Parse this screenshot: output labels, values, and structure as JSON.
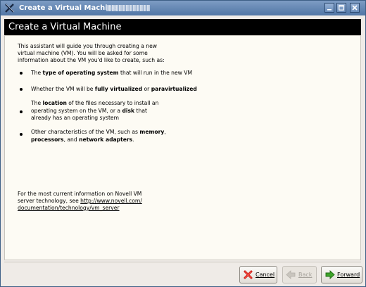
{
  "window": {
    "title": "Create a Virtual Machine"
  },
  "banner": {
    "title": "Create a Virtual Machine"
  },
  "intro": [
    "This assistant will guide you through creating a new",
    "virtual machine (VM).  You will be asked for some",
    "information about the VM you'd like to create, such as:"
  ],
  "bullets": {
    "os": {
      "pre": "The ",
      "b1": "type of operating system",
      "post": " that will run in the new VM"
    },
    "virt": {
      "pre": "Whether the VM will be ",
      "b1": "fully virtualized",
      "mid": " or ",
      "b2": "paravirtualized"
    },
    "location": {
      "line1_pre": "The ",
      "line1_b": "location",
      "line1_post": " of the files necessary to install an",
      "line2_pre": "operating system on the VM, or a ",
      "line2_b": "disk",
      "line2_post": " that",
      "line3": "already has an operating system"
    },
    "other": {
      "line1_pre": "Other characteristics of the VM, such as ",
      "line1_b": "memory",
      "line1_post": ",",
      "line2_b1": "processors",
      "line2_mid": ", and ",
      "line2_b2": "network adapters",
      "line2_post": "."
    }
  },
  "footer_info": {
    "line1": "For the most current information on Novell VM",
    "line2_pre": "server technology, see ",
    "link_part1": "http://www.novell.com/",
    "link_part2": "documentation/technology/vm_server"
  },
  "buttons": {
    "cancel": "Cancel",
    "back": "Back",
    "forward": "Forward"
  },
  "colors": {
    "titlebar": "#5176a5",
    "banner": "#000000",
    "content_bg": "#fdfbf4",
    "window_bg": "#efebe7"
  }
}
